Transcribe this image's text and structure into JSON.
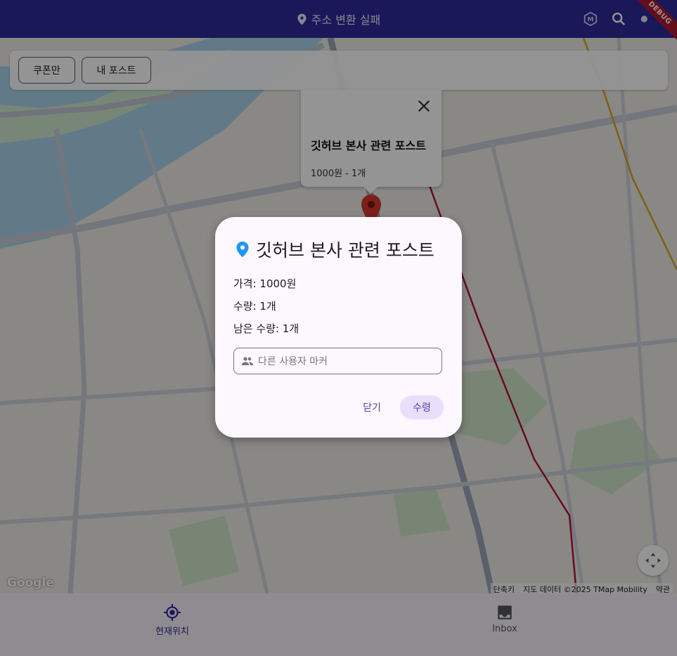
{
  "appbar": {
    "title": "주소 변환 실패",
    "debug_label": "DEBUG"
  },
  "filters": {
    "coupon_only": "쿠폰만",
    "my_posts": "내 포스트"
  },
  "info_window": {
    "title": "깃허브 본사 관련 포스트",
    "subtitle": "1000원 - 1개"
  },
  "map": {
    "logo": "Google",
    "attribution": {
      "shortcuts": "단축키",
      "map_data": "지도 데이터 ©2025 TMap Mobility",
      "terms": "약관"
    }
  },
  "dialog": {
    "title": "깃허브 본사 관련 포스트",
    "price": "가격: 1000원",
    "quantity": "수량: 1개",
    "remaining": "남은 수량: 1개",
    "marker_placeholder": "다른 사용자 마커",
    "close_label": "닫기",
    "claim_label": "수령"
  },
  "bottom_nav": {
    "items": [
      {
        "label": "현재위치",
        "icon": "gps-fixed-icon",
        "selected": true
      },
      {
        "label": "Inbox",
        "icon": "inbox-icon",
        "selected": false
      }
    ]
  },
  "colors": {
    "appbar": "#2e2a9a",
    "accent": "#4a44a8",
    "marker": "#d23a2f",
    "dialog_bg": "#fdf7fe"
  }
}
